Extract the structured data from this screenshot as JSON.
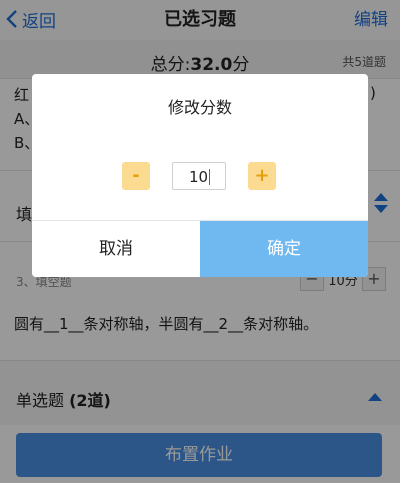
{
  "nav": {
    "back_label": "返回",
    "title": "已选习题",
    "edit_label": "编辑"
  },
  "summary": {
    "total_prefix": "总分:",
    "total_value": "32.0",
    "total_unit": "分",
    "count_label": "共5道题"
  },
  "background_question": {
    "partial_line": "红",
    "partial_line_end": ")",
    "option_a": "A、",
    "option_b": "B、"
  },
  "fill_section": {
    "label": "填"
  },
  "question3": {
    "meta": "3、填空题",
    "score_minus": "−",
    "score_value": "10分",
    "score_plus": "+",
    "text": "圆有__1__条对称轴，半圆有__2__条对称轴。"
  },
  "single_choice": {
    "label": "单选题",
    "count": "(2道)"
  },
  "footer": {
    "assign_label": "布置作业"
  },
  "modal": {
    "title": "修改分数",
    "minus_label": "-",
    "value": "10",
    "plus_label": "+",
    "cancel_label": "取消",
    "confirm_label": "确定"
  },
  "colors": {
    "accent_blue": "#1e6fd9",
    "confirm_button": "#70b8f0",
    "stepper_button": "#fbdb91",
    "stepper_glyph": "#e8a00a",
    "assign_button": "#4a90e2"
  }
}
